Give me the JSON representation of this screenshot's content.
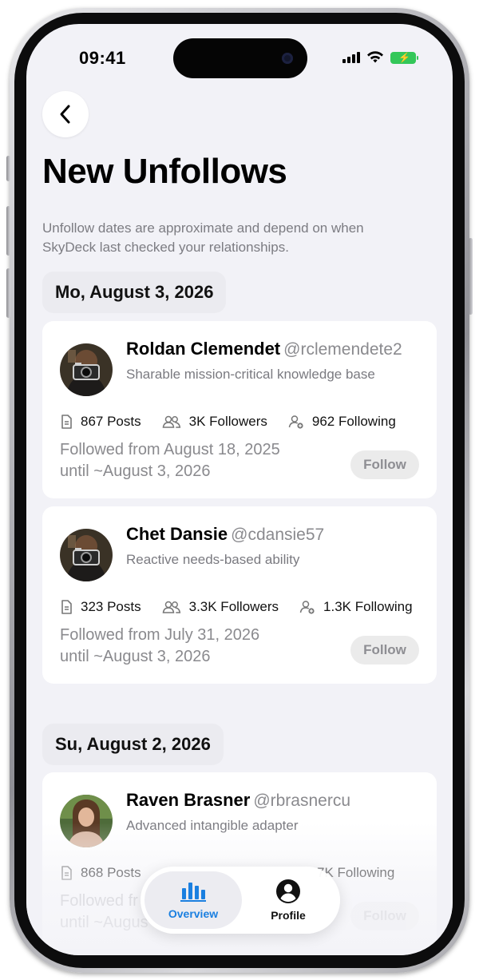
{
  "status_bar": {
    "time": "09:41"
  },
  "header": {
    "title": "New Unfollows"
  },
  "note": "Unfollow dates are approximate and depend on when SkyDeck last checked your relationships.",
  "colors": {
    "accent": "#1a7fe0",
    "background": "#f2f2f7",
    "battery": "#34c759"
  },
  "days": [
    {
      "date": "Mo, August 3, 2026",
      "users": [
        {
          "name": "Roldan Clemendet",
          "handle": "@rclemendete2",
          "bio": "Sharable mission-critical knowledge base",
          "posts": "867 Posts",
          "followers": "3K Followers",
          "following": "962 Following",
          "since_line1": "Followed from August 18, 2025",
          "since_line2": "until ~August 3, 2026",
          "button": "Follow"
        },
        {
          "name": "Chet Dansie",
          "handle": "@cdansie57",
          "bio": "Reactive needs-based ability",
          "posts": "323 Posts",
          "followers": "3.3K Followers",
          "following": "1.3K Following",
          "since_line1": "Followed from July 31, 2026",
          "since_line2": "until ~August 3, 2026",
          "button": "Follow"
        }
      ]
    },
    {
      "date": "Su, August 2, 2026",
      "users": [
        {
          "name": "Raven Brasner",
          "handle": "@rbrasnercu",
          "bio": "Advanced intangible adapter",
          "posts": "868 Posts",
          "followers": "",
          "following": "7K Following",
          "since_line1": "Followed fr",
          "since_line2": "until ~Augus",
          "button": "Follow"
        }
      ]
    }
  ],
  "tabbar": {
    "overview": "Overview",
    "profile": "Profile"
  }
}
